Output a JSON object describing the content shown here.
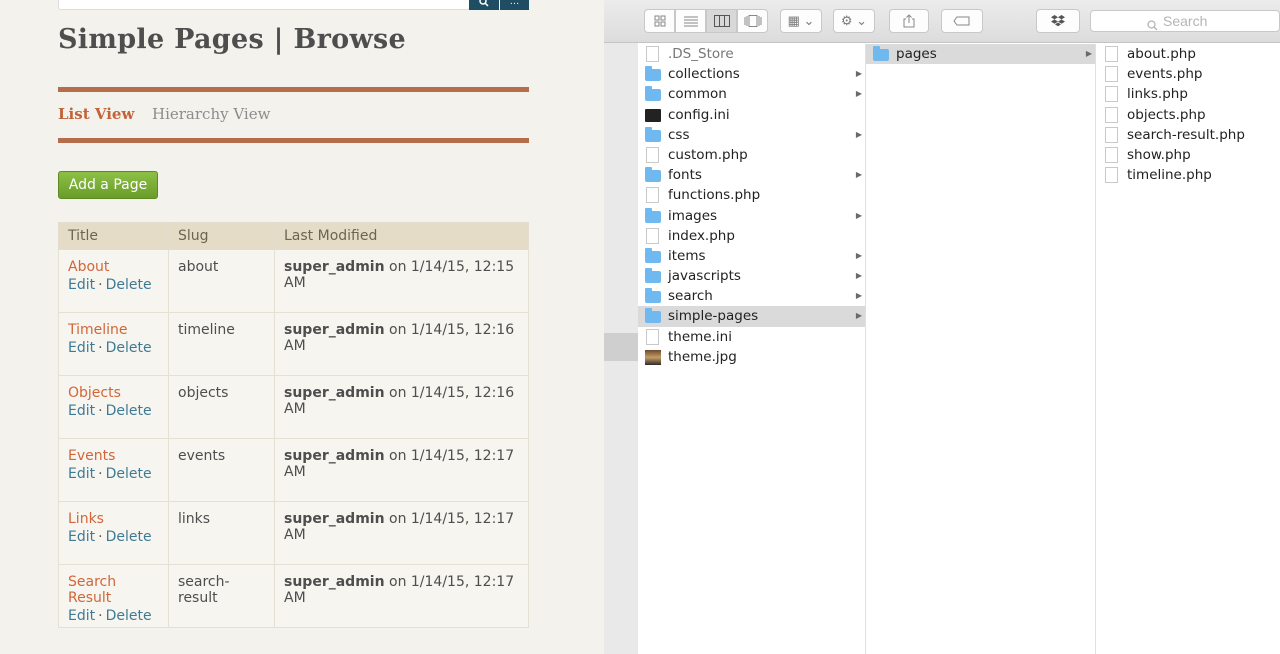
{
  "omeka": {
    "search_button_icon": "search-icon",
    "advanced_search_icon": "ellipsis-icon",
    "page_title": "Simple Pages | Browse",
    "tabs": [
      {
        "label": "List View",
        "active": true
      },
      {
        "label": "Hierarchy View",
        "active": false
      }
    ],
    "add_button": "Add a Page",
    "table": {
      "headers": [
        "Title",
        "Slug",
        "Last Modified"
      ],
      "edit_label": "Edit",
      "delete_label": "Delete",
      "separator": "·",
      "rows": [
        {
          "title": "About",
          "slug": "about",
          "author": "super_admin",
          "date": "on 1/14/15, 12:15 AM"
        },
        {
          "title": "Timeline",
          "slug": "timeline",
          "author": "super_admin",
          "date": "on 1/14/15, 12:16 AM"
        },
        {
          "title": "Objects",
          "slug": "objects",
          "author": "super_admin",
          "date": "on 1/14/15, 12:16 AM"
        },
        {
          "title": "Events",
          "slug": "events",
          "author": "super_admin",
          "date": "on 1/14/15, 12:17 AM"
        },
        {
          "title": "Links",
          "slug": "links",
          "author": "super_admin",
          "date": "on 1/14/15, 12:17 AM"
        },
        {
          "title": "Search Result",
          "slug": "search-result",
          "author": "super_admin",
          "date": "on 1/14/15, 12:17 AM"
        }
      ]
    },
    "colors": {
      "accent_rule": "#b56d4c",
      "link_orange": "#d0663a",
      "link_blue": "#3f7a95",
      "add_button_green": "#7bb33a"
    }
  },
  "finder": {
    "toolbar": {
      "view_icons": [
        "icon-view-icon",
        "list-view-icon",
        "column-view-icon",
        "coverflow-view-icon"
      ],
      "active_view": "column-view-icon",
      "arrange_icon": "arrange-icon",
      "action_icon": "gear-icon",
      "share_icon": "share-icon",
      "tag_icon": "tag-icon",
      "dropbox_icon": "dropbox-icon",
      "search_placeholder": "Search"
    },
    "column1": [
      {
        "name": ".DS_Store",
        "kind": "file",
        "dim": true
      },
      {
        "name": "collections",
        "kind": "folder",
        "arrow": true
      },
      {
        "name": "common",
        "kind": "folder",
        "arrow": true
      },
      {
        "name": "config.ini",
        "kind": "black"
      },
      {
        "name": "css",
        "kind": "folder",
        "arrow": true
      },
      {
        "name": "custom.php",
        "kind": "file"
      },
      {
        "name": "fonts",
        "kind": "folder",
        "arrow": true
      },
      {
        "name": "functions.php",
        "kind": "file"
      },
      {
        "name": "images",
        "kind": "folder",
        "arrow": true
      },
      {
        "name": "index.php",
        "kind": "file"
      },
      {
        "name": "items",
        "kind": "folder",
        "arrow": true
      },
      {
        "name": "javascripts",
        "kind": "folder",
        "arrow": true
      },
      {
        "name": "search",
        "kind": "folder",
        "arrow": true
      },
      {
        "name": "simple-pages",
        "kind": "folder",
        "arrow": true,
        "selected": true
      },
      {
        "name": "theme.ini",
        "kind": "file"
      },
      {
        "name": "theme.jpg",
        "kind": "image"
      }
    ],
    "column2": [
      {
        "name": "pages",
        "kind": "folder",
        "arrow": true,
        "selected": true
      }
    ],
    "column3": [
      {
        "name": "about.php",
        "kind": "file"
      },
      {
        "name": "events.php",
        "kind": "file"
      },
      {
        "name": "links.php",
        "kind": "file"
      },
      {
        "name": "objects.php",
        "kind": "file"
      },
      {
        "name": "search-result.php",
        "kind": "file"
      },
      {
        "name": "show.php",
        "kind": "file"
      },
      {
        "name": "timeline.php",
        "kind": "file"
      }
    ],
    "arrow_glyph": "▶"
  }
}
